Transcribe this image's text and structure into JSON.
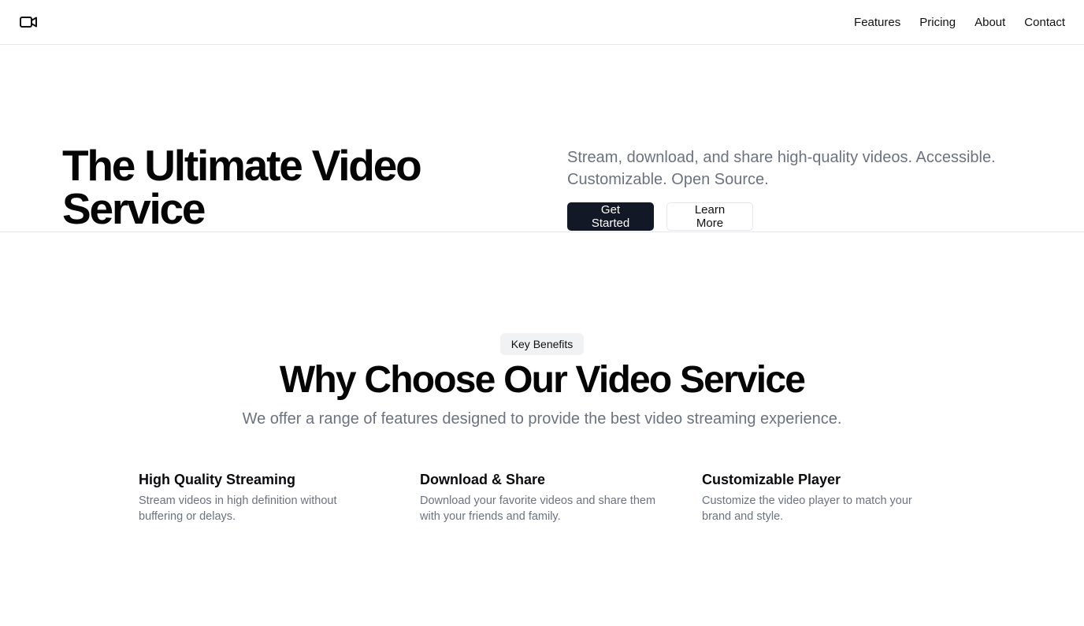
{
  "header": {
    "logo_icon": "video-camera-icon",
    "nav": [
      {
        "label": "Features"
      },
      {
        "label": "Pricing"
      },
      {
        "label": "About"
      },
      {
        "label": "Contact"
      }
    ]
  },
  "hero": {
    "title": "The Ultimate Video Service",
    "subtitle": "Stream, download, and share high-quality videos. Accessible. Customizable. Open Source.",
    "primary_button": "Get Started",
    "secondary_button": "Learn More"
  },
  "benefits": {
    "badge": "Key Benefits",
    "title": "Why Choose Our Video Service",
    "subtitle": "We offer a range of features designed to provide the best video streaming experience.",
    "features": [
      {
        "title": "High Quality Streaming",
        "description": "Stream videos in high definition without buffering or delays."
      },
      {
        "title": "Download & Share",
        "description": "Download your favorite videos and share them with your friends and family."
      },
      {
        "title": "Customizable Player",
        "description": "Customize the video player to match your brand and style."
      }
    ]
  },
  "colors": {
    "primary_button": "#121826",
    "muted_text": "#6b7280",
    "border": "#e5e7eb",
    "badge_bg": "#f1f2f4"
  }
}
